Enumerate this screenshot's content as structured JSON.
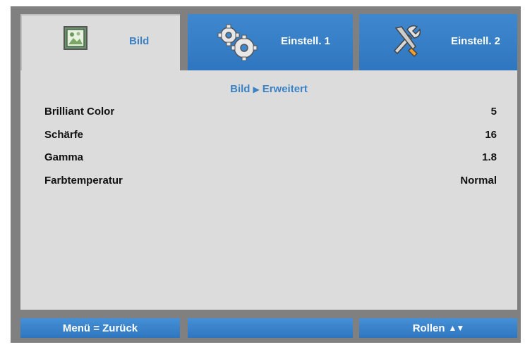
{
  "tabs": [
    {
      "label": "Bild",
      "icon": "picture-icon",
      "active": true
    },
    {
      "label": "Einstell. 1",
      "icon": "gears-icon",
      "active": false
    },
    {
      "label": "Einstell. 2",
      "icon": "tools-icon",
      "active": false
    }
  ],
  "breadcrumb": {
    "parent": "Bild",
    "separator": "▶",
    "current": "Erweitert"
  },
  "settings": [
    {
      "label": "Brilliant Color",
      "value": "5"
    },
    {
      "label": "Schärfe",
      "value": "16"
    },
    {
      "label": "Gamma",
      "value": "1.8"
    },
    {
      "label": "Farbtemperatur",
      "value": "Normal"
    }
  ],
  "footer": {
    "back_label": "Menü = Zurück",
    "middle_label": "",
    "scroll_label": "Rollen",
    "scroll_arrows": "▲▼"
  },
  "colors": {
    "accent": "#3b82c4",
    "tab_blue": "#2f76c0",
    "panel": "#dcdcdc",
    "frame": "#808080"
  }
}
